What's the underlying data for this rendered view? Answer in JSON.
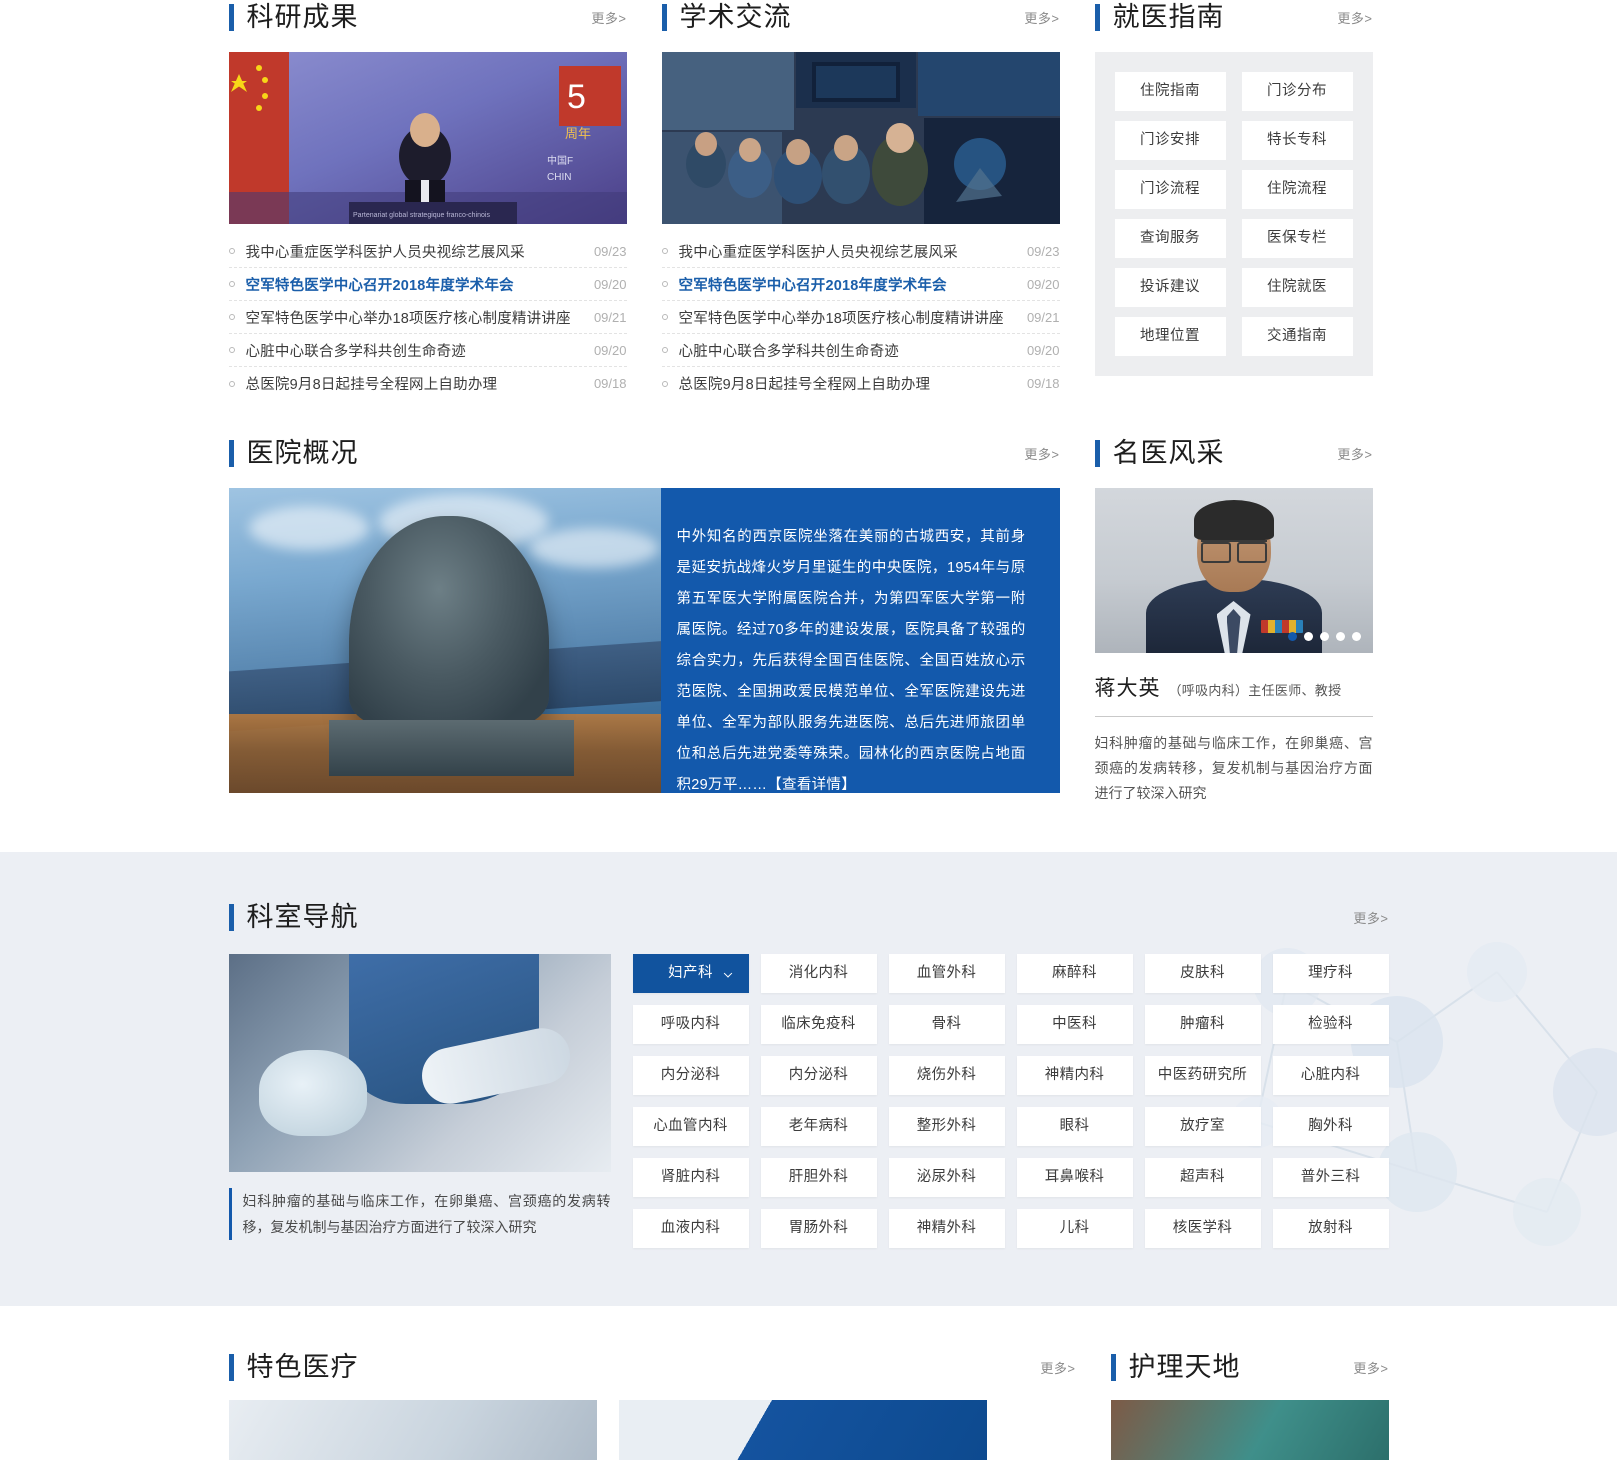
{
  "sections": {
    "research": {
      "title": "科研成果",
      "more": "更多>"
    },
    "academic": {
      "title": "学术交流",
      "more": "更多>"
    },
    "guide": {
      "title": "就医指南",
      "more": "更多>"
    },
    "overview": {
      "title": "医院概况",
      "more": "更多>"
    },
    "famous": {
      "title": "名医风采",
      "more": "更多>"
    },
    "dept": {
      "title": "科室导航",
      "more": "更多>"
    },
    "special": {
      "title": "特色医疗",
      "more": "更多>"
    },
    "nursing": {
      "title": "护理天地",
      "more": "更多>"
    }
  },
  "research_news": [
    {
      "text": "我中心重症医学科医护人员央视综艺展风采",
      "date": "09/23",
      "active": false
    },
    {
      "text": "空军特色医学中心召开2018年度学术年会",
      "date": "09/20",
      "active": true
    },
    {
      "text": "空军特色医学中心举办18项医疗核心制度精讲讲座",
      "date": "09/21",
      "active": false
    },
    {
      "text": "心脏中心联合多学科共创生命奇迹",
      "date": "09/20",
      "active": false
    },
    {
      "text": "总医院9月8日起挂号全程网上自助办理",
      "date": "09/18",
      "active": false
    }
  ],
  "academic_news": [
    {
      "text": "我中心重症医学科医护人员央视综艺展风采",
      "date": "09/23",
      "active": false
    },
    {
      "text": "空军特色医学中心召开2018年度学术年会",
      "date": "09/20",
      "active": true
    },
    {
      "text": "空军特色医学中心举办18项医疗核心制度精讲讲座",
      "date": "09/21",
      "active": false
    },
    {
      "text": "心脏中心联合多学科共创生命奇迹",
      "date": "09/20",
      "active": false
    },
    {
      "text": "总医院9月8日起挂号全程网上自助办理",
      "date": "09/18",
      "active": false
    }
  ],
  "guide_buttons": [
    "住院指南",
    "门诊分布",
    "门诊安排",
    "特长专科",
    "门诊流程",
    "住院流程",
    "查询服务",
    "医保专栏",
    "投诉建议",
    "住院就医",
    "地理位置",
    "交通指南"
  ],
  "overview_text": "中外知名的西京医院坐落在美丽的古城西安，其前身是延安抗战烽火岁月里诞生的中央医院，1954年与原第五军医大学附属医院合并，为第四军医大学第一附属医院。经过70多年的建设发展，医院具备了较强的综合实力，先后获得全国百佳医院、全国百姓放心示范医院、全国拥政爱民模范单位、全军医院建设先进单位、全军为部队服务先进医院、总后先进师旅团单位和总后先进党委等殊荣。园林化的西京医院占地面积29万平……",
  "overview_link": "【查看详情】",
  "doctor": {
    "name": "蒋大英",
    "meta": "（呼吸内科）主任医师、教授",
    "desc": "妇科肿瘤的基础与临床工作，在卵巢癌、宫颈癌的发病转移，复发机制与基因治疗方面进行了较深入研究",
    "carousel_dots": 5,
    "active_dot": 0
  },
  "department": {
    "caption": "妇科肿瘤的基础与临床工作，在卵巢癌、宫颈癌的发病转移，复发机制与基因治疗方面进行了较深入研究",
    "selected": "妇产科",
    "buttons": [
      "妇产科",
      "消化内科",
      "血管外科",
      "麻醉科",
      "皮肤科",
      "理疗科",
      "呼吸内科",
      "临床免疫科",
      "骨科",
      "中医科",
      "肿瘤科",
      "检验科",
      "内分泌科",
      "内分泌科",
      "烧伤外科",
      "神精内科",
      "中医药研究所",
      "心脏内科",
      "心血管内科",
      "老年病科",
      "整形外科",
      "眼科",
      "放疗室",
      "胸外科",
      "肾脏内科",
      "肝胆外科",
      "泌尿外科",
      "耳鼻喉科",
      "超声科",
      "普外三科",
      "血液内科",
      "胃肠外科",
      "神精外科",
      "儿科",
      "核医学科",
      "放射科"
    ]
  },
  "colors": {
    "accent": "#1359ac",
    "title_bar": "#1a5eaa",
    "selected_tab": "#11539e",
    "band_bg": "#eceff4",
    "guide_bg": "#edeef0",
    "news_active": "#1a5eaa"
  }
}
